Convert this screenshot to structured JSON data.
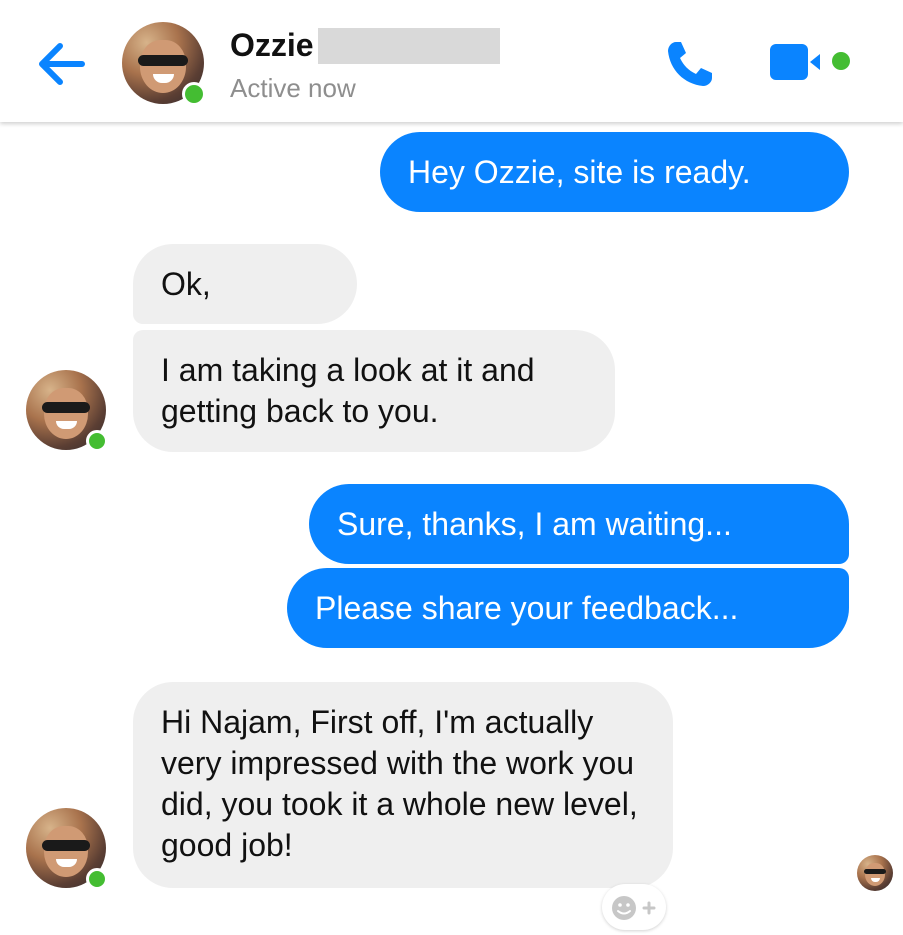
{
  "header": {
    "contact_name": "Ozzie",
    "status": "Active now",
    "icons": {
      "back": "back-arrow-icon",
      "call": "phone-icon",
      "video": "video-camera-icon"
    }
  },
  "colors": {
    "accent": "#0a84ff",
    "active": "#44bd32",
    "incoming_bubble": "#efefef",
    "status_text": "#8e8e8e"
  },
  "messages": [
    {
      "direction": "outgoing",
      "text": "Hey Ozzie, site is ready."
    },
    {
      "direction": "incoming",
      "text": "Ok,"
    },
    {
      "direction": "incoming",
      "text": "I am taking a look at it and getting back to you."
    },
    {
      "direction": "outgoing",
      "text": "Sure, thanks, I am waiting..."
    },
    {
      "direction": "outgoing",
      "text": "Please share your feedback..."
    },
    {
      "direction": "incoming",
      "text": "Hi Najam, First off, I'm actually very impressed with the work you did, you took it a whole new level, good job!"
    }
  ],
  "reaction_button": {
    "icon": "add-reaction-icon"
  }
}
